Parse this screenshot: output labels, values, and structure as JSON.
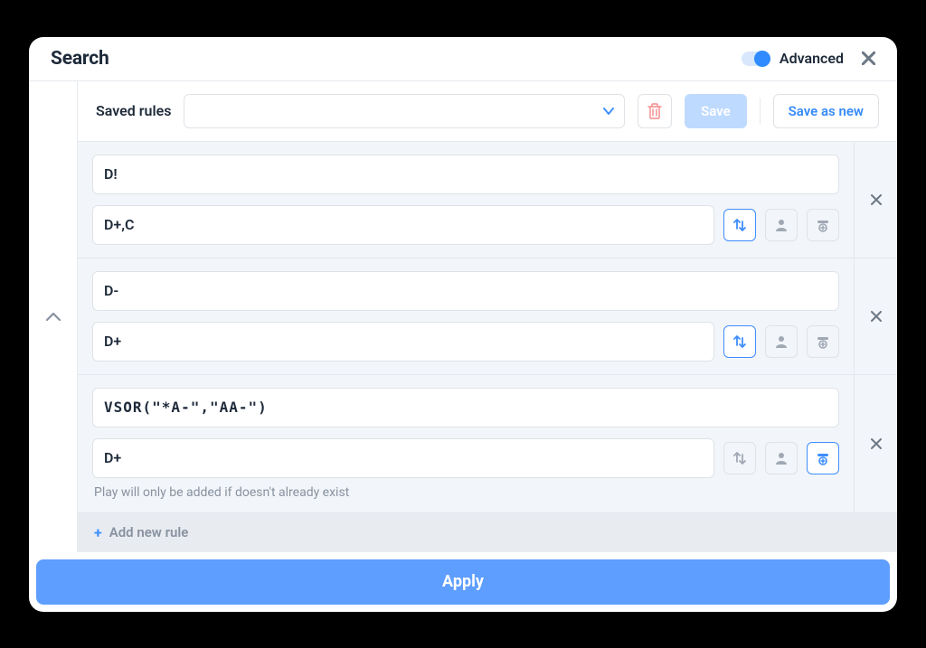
{
  "header": {
    "title": "Search",
    "advanced_label": "Advanced",
    "advanced_on": true
  },
  "saved_rules": {
    "label": "Saved rules",
    "selected": "",
    "save_label": "Save",
    "save_as_label": "Save as new"
  },
  "rules": [
    {
      "line1": "D!",
      "line2": "D+,C",
      "swap_active": true,
      "add_active": false,
      "hint": ""
    },
    {
      "line1": "D-",
      "line2": "D+",
      "swap_active": true,
      "add_active": false,
      "hint": ""
    },
    {
      "line1": "VSOR(\"*A-\",\"AA-\")",
      "line2": "D+",
      "swap_active": false,
      "add_active": true,
      "hint": "Play will only be added if doesn't already exist",
      "mono": true
    }
  ],
  "add_rule_label": "Add new rule",
  "apply_label": "Apply"
}
